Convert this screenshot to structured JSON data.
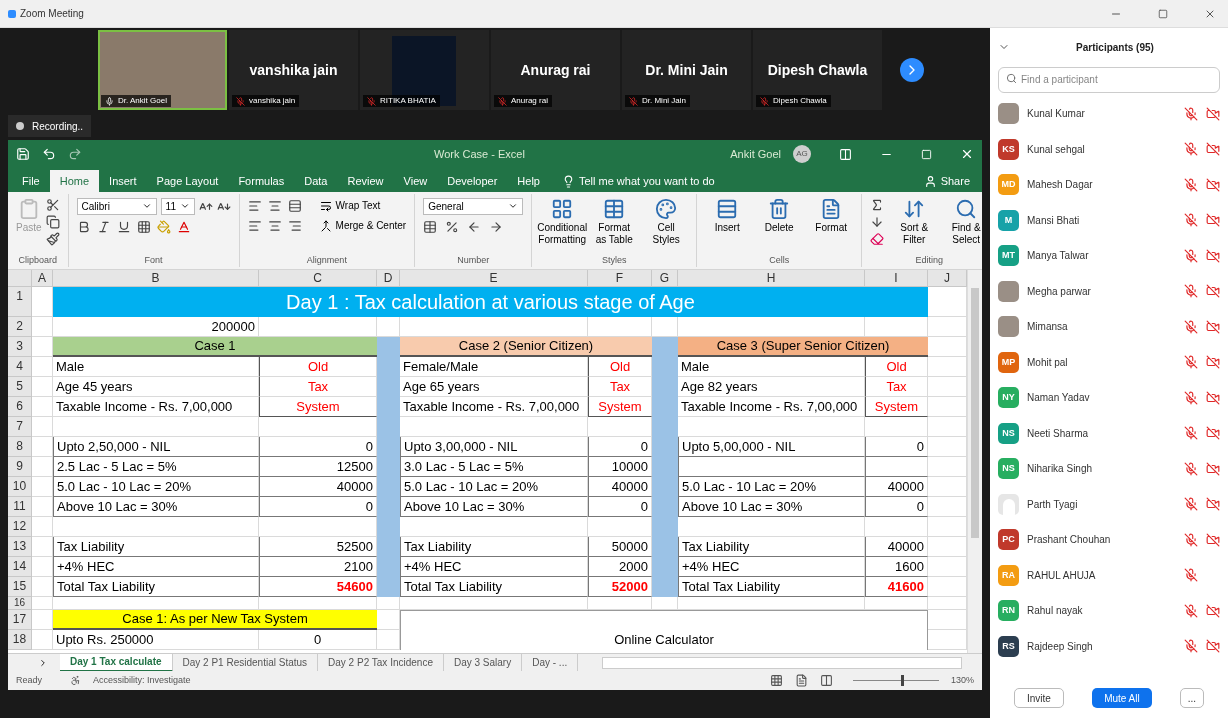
{
  "window": {
    "title": "Zoom Meeting"
  },
  "video_strip": {
    "tiles": [
      {
        "kind": "video",
        "label": "Dr. Ankit Goel",
        "muted": false
      },
      {
        "kind": "name",
        "name": "vanshika jain",
        "label": "vanshika jain",
        "muted": true
      },
      {
        "kind": "image",
        "label": "RITIKA BHATIA",
        "muted": true
      },
      {
        "kind": "name",
        "name": "Anurag rai",
        "label": "Anurag rai",
        "muted": true
      },
      {
        "kind": "name",
        "name": "Dr. Mini Jain",
        "label": "Dr. Mini Jain",
        "muted": true
      },
      {
        "kind": "name",
        "name": "Dipesh Chawla",
        "label": "Dipesh Chawla",
        "muted": true
      }
    ]
  },
  "recording": {
    "label": "Recording.."
  },
  "excel": {
    "title": "Work Case - Excel",
    "user": "Ankit Goel",
    "initials": "AG",
    "tabs": [
      {
        "label": "File",
        "selected": false
      },
      {
        "label": "Home",
        "selected": true
      },
      {
        "label": "Insert",
        "selected": false
      },
      {
        "label": "Page Layout",
        "selected": false
      },
      {
        "label": "Formulas",
        "selected": false
      },
      {
        "label": "Data",
        "selected": false
      },
      {
        "label": "Review",
        "selected": false
      },
      {
        "label": "View",
        "selected": false
      },
      {
        "label": "Developer",
        "selected": false
      },
      {
        "label": "Help",
        "selected": false
      }
    ],
    "tell_me": "Tell me what you want to do",
    "share": "Share",
    "ribbon": [
      {
        "kind": "clipboard",
        "label": "Clipboard",
        "paste": "Paste"
      },
      {
        "kind": "font",
        "label": "Font",
        "font_name": "Calibri",
        "font_size": "11"
      },
      {
        "kind": "alignment",
        "label": "Alignment",
        "wrap": "Wrap Text",
        "merge": "Merge & Center"
      },
      {
        "kind": "number",
        "label": "Number",
        "format": "General"
      },
      {
        "kind": "buttons",
        "label": "Styles",
        "buttons": [
          "Conditional Formatting",
          "Format as Table",
          "Cell Styles"
        ]
      },
      {
        "kind": "buttons",
        "label": "Cells",
        "buttons": [
          "Insert",
          "Delete",
          "Format"
        ]
      },
      {
        "kind": "buttons",
        "label": "Editing",
        "buttons": [
          "Sort & Filter",
          "Find & Select"
        ]
      }
    ],
    "sheet": {
      "columns": [
        "A",
        "B",
        "C",
        "D",
        "E",
        "F",
        "G",
        "H",
        "I",
        "J"
      ],
      "row_numbers": [
        "1",
        "2",
        "3",
        "4",
        "5",
        "6",
        "7",
        "8",
        "9",
        "10",
        "11",
        "12",
        "13",
        "14",
        "15",
        "16",
        "17",
        "18"
      ],
      "title": "Day 1 : Tax calculation at various stage of Age",
      "base_value": "200000",
      "cases": [
        {
          "header": "Case 1",
          "color": "#a9d08e",
          "lines": [
            "Male",
            "Age 45 years",
            "Taxable Income - Rs. 7,00,000"
          ],
          "system": [
            "Old",
            "Tax",
            "System"
          ],
          "brackets": [
            {
              "label": "Upto 2,50,000 - NIL",
              "amount": "0"
            },
            {
              "label": "2.5 Lac - 5 Lac = 5%",
              "amount": "12500"
            },
            {
              "label": "5.0 Lac - 10 Lac = 20%",
              "amount": "40000"
            },
            {
              "label": "Above 10 Lac = 30%",
              "amount": "0"
            }
          ],
          "summary": [
            {
              "label": "Tax Liability",
              "amount": "52500",
              "highlight": false
            },
            {
              "label": "+4% HEC",
              "amount": "2100",
              "highlight": false
            },
            {
              "label": "Total Tax Liability",
              "amount": "54600",
              "highlight": true
            }
          ]
        },
        {
          "header": "Case 2 (Senior Citizen)",
          "color": "#f8cbad",
          "lines": [
            "Female/Male",
            "Age 65 years",
            "Taxable Income - Rs. 7,00,000"
          ],
          "system": [
            "Old",
            "Tax",
            "System"
          ],
          "brackets": [
            {
              "label": "Upto 3,00,000 - NIL",
              "amount": "0"
            },
            {
              "label": "3.0 Lac - 5 Lac = 5%",
              "amount": "10000"
            },
            {
              "label": "5.0 Lac - 10 Lac = 20%",
              "amount": "40000"
            },
            {
              "label": "Above 10 Lac = 30%",
              "amount": "0"
            }
          ],
          "summary": [
            {
              "label": "Tax Liability",
              "amount": "50000",
              "highlight": false
            },
            {
              "label": "+4% HEC",
              "amount": "2000",
              "highlight": false
            },
            {
              "label": "Total Tax Liability",
              "amount": "52000",
              "highlight": true
            }
          ]
        },
        {
          "header": "Case 3 (Super Senior Citizen)",
          "color": "#f4b084",
          "lines": [
            "Male",
            "Age 82 years",
            "Taxable Income - Rs. 7,00,000"
          ],
          "system": [
            "Old",
            "Tax",
            "System"
          ],
          "brackets": [
            {
              "label": "Upto 5,00,000 - NIL",
              "amount": "0"
            },
            {
              "kind": "blank"
            },
            {
              "label": "5.0 Lac - 10 Lac = 20%",
              "amount": "40000"
            },
            {
              "label": "Above 10 Lac = 30%",
              "amount": "0"
            }
          ],
          "summary": [
            {
              "label": "Tax Liability",
              "amount": "40000",
              "highlight": false
            },
            {
              "label": "+4% HEC",
              "amount": "1600",
              "highlight": false
            },
            {
              "label": "Total Tax Liability",
              "amount": "41600",
              "highlight": true
            }
          ]
        }
      ],
      "new_system_banner": "Case 1: As per New Tax System",
      "new_first_label": "Upto Rs. 250000",
      "new_first_amount": "0",
      "online_calculator": "Online Calculator"
    },
    "sheet_tabs": [
      {
        "label": "Day 1 Tax calculate",
        "selected": true
      },
      {
        "label": "Day 2 P1 Residential Status",
        "selected": false
      },
      {
        "label": "Day 2 P2 Tax Incidence",
        "selected": false
      },
      {
        "label": "Day 3 Salary",
        "selected": false
      },
      {
        "label": "Day - ...",
        "selected": false
      }
    ],
    "status": {
      "ready": "Ready",
      "accessibility": "Accessibility: Investigate",
      "zoom": "130%",
      "zoom_level": {
        "level": 0.56
      }
    }
  },
  "participants": {
    "title": "Participants (95)",
    "search": {
      "placeholder": "Find a participant"
    },
    "items": [
      {
        "name": "Kunal Kumar",
        "avatar": {
          "kind": "photo"
        },
        "muted": true,
        "video_off": true
      },
      {
        "name": "Kunal sehgal",
        "avatar": {
          "kind": "initials",
          "initials": "KS",
          "color": "#c0392b"
        },
        "muted": true,
        "video_off": true
      },
      {
        "name": "Mahesh Dagar",
        "avatar": {
          "kind": "initials",
          "initials": "MD",
          "color": "#f39c12"
        },
        "muted": true,
        "video_off": true
      },
      {
        "name": "Mansi Bhati",
        "avatar": {
          "kind": "initials",
          "initials": "M",
          "color": "#17a2a8"
        },
        "muted": true,
        "video_off": true
      },
      {
        "name": "Manya Talwar",
        "avatar": {
          "kind": "initials",
          "initials": "MT",
          "color": "#16a085"
        },
        "muted": true,
        "video_off": true
      },
      {
        "name": "Megha parwar",
        "avatar": {
          "kind": "photo"
        },
        "muted": true,
        "video_off": true
      },
      {
        "name": "Mimansa",
        "avatar": {
          "kind": "photo"
        },
        "muted": true,
        "video_off": true
      },
      {
        "name": "Mohit pal",
        "avatar": {
          "kind": "initials",
          "initials": "MP",
          "color": "#e0650f"
        },
        "muted": true,
        "video_off": true
      },
      {
        "name": "Naman Yadav",
        "avatar": {
          "kind": "initials",
          "initials": "NY",
          "color": "#27ae60"
        },
        "muted": true,
        "video_off": true
      },
      {
        "name": "Neeti Sharma",
        "avatar": {
          "kind": "initials",
          "initials": "NS",
          "color": "#16a085"
        },
        "muted": true,
        "video_off": true
      },
      {
        "name": "Niharika Singh",
        "avatar": {
          "kind": "initials",
          "initials": "NS",
          "color": "#27ae60"
        },
        "muted": true,
        "video_off": true
      },
      {
        "name": "Parth Tyagi",
        "avatar": {
          "kind": "silhouette"
        },
        "muted": true,
        "video_off": true
      },
      {
        "name": "Prashant Chouhan",
        "avatar": {
          "kind": "initials",
          "initials": "PC",
          "color": "#c0392b"
        },
        "muted": true,
        "video_off": true
      },
      {
        "name": "RAHUL AHUJA",
        "avatar": {
          "kind": "initials",
          "initials": "RA",
          "color": "#f39c12"
        },
        "muted": true,
        "video_off": false
      },
      {
        "name": "Rahul nayak",
        "avatar": {
          "kind": "initials",
          "initials": "RN",
          "color": "#27ae60"
        },
        "muted": true,
        "video_off": true
      },
      {
        "name": "Rajdeep Singh",
        "avatar": {
          "kind": "initials",
          "initials": "RS",
          "color": "#2c3e50"
        },
        "muted": true,
        "video_off": true
      }
    ],
    "buttons": {
      "invite": "Invite",
      "mute_all": "Mute All",
      "more": "..."
    }
  }
}
